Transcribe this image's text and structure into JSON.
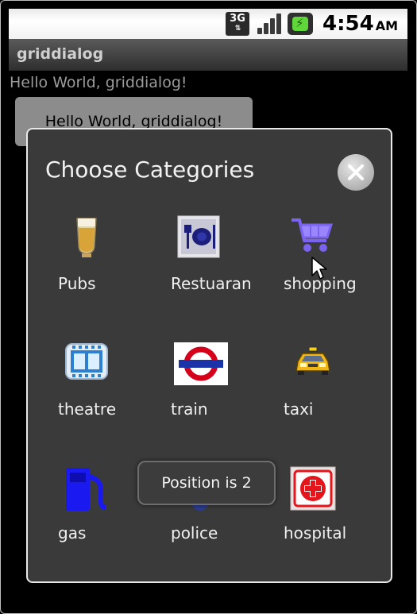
{
  "status_bar": {
    "network": "3G",
    "time": "4:54",
    "ampm": "AM"
  },
  "app": {
    "title": "griddialog",
    "hello_text": "Hello World, griddialog!",
    "button_label": "Hello World, griddialog!"
  },
  "dialog": {
    "title": "Choose Categories",
    "items": [
      {
        "label": "Pubs",
        "icon": "beer-icon"
      },
      {
        "label": "Restuaran",
        "icon": "restaurant-icon"
      },
      {
        "label": "shopping",
        "icon": "shopping-cart-icon"
      },
      {
        "label": "theatre",
        "icon": "film-icon"
      },
      {
        "label": "train",
        "icon": "underground-icon"
      },
      {
        "label": "taxi",
        "icon": "taxi-icon"
      },
      {
        "label": "gas",
        "icon": "gas-pump-icon"
      },
      {
        "label": "police",
        "icon": "police-icon"
      },
      {
        "label": "hospital",
        "icon": "hospital-icon"
      }
    ]
  },
  "toast": {
    "text": "Position is 2"
  },
  "colors": {
    "dialog_bg": "#3a3a3a",
    "cart_purple": "#7b63f0",
    "gas_blue": "#1a1af0",
    "train_red": "#d5001a",
    "hospital_red": "#e4161b",
    "battery_green": "#5fd63a"
  }
}
